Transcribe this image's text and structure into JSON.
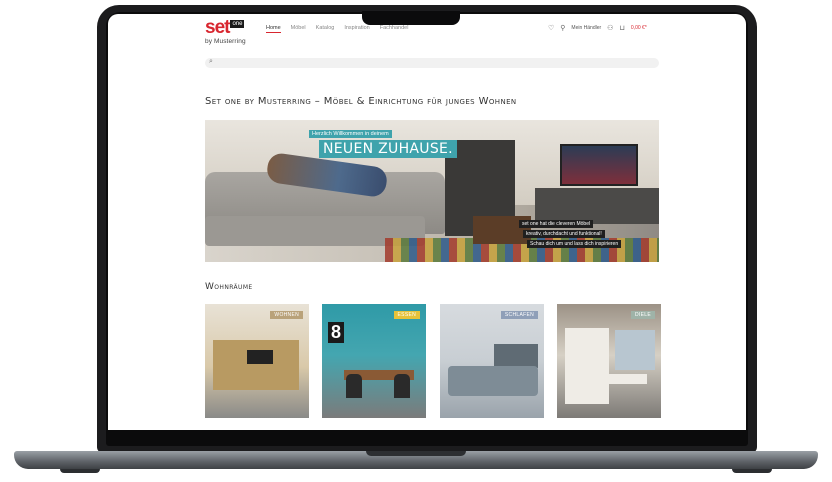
{
  "brand": {
    "name": "set",
    "superscript": "one",
    "byline": "by Musterring",
    "accent": "#d8262f"
  },
  "nav": {
    "items": [
      {
        "label": "Home",
        "active": true
      },
      {
        "label": "Möbel",
        "active": false
      },
      {
        "label": "Katalog",
        "active": false
      },
      {
        "label": "Inspiration",
        "active": false
      },
      {
        "label": "Fachhandel",
        "active": false
      }
    ]
  },
  "header_icons": {
    "wishlist_icon": "heart-icon",
    "location_icon": "pin-icon",
    "location_label": "Mein Händler",
    "account_icon": "user-icon",
    "cart_icon": "cart-icon",
    "cart_total": "0,00 €*"
  },
  "search": {
    "icon": "search-icon",
    "placeholder": ""
  },
  "page": {
    "headline": "Set one by Musterring – Möbel & Einrichtung für junges Wohnen"
  },
  "hero": {
    "badge_small": "Herzlich Willkommen in deinem",
    "badge_large": "NEUEN ZUHAUSE.",
    "caption_lines": [
      "set one hat die cleveren Möbel",
      "kreativ, durchdacht und funktional!",
      "Schau dich um und lass dich inspirieren"
    ]
  },
  "rooms": {
    "heading": "Wohnräume",
    "tiles": [
      {
        "tag": "WOHNEN",
        "color": "#b9a27a"
      },
      {
        "tag": "ESSEN",
        "color": "#e7c23a"
      },
      {
        "tag": "SCHLAFEN",
        "color": "#8f9fb8"
      },
      {
        "tag": "DIELE",
        "color": "#9fb3a8"
      }
    ],
    "tile_number": "8"
  }
}
